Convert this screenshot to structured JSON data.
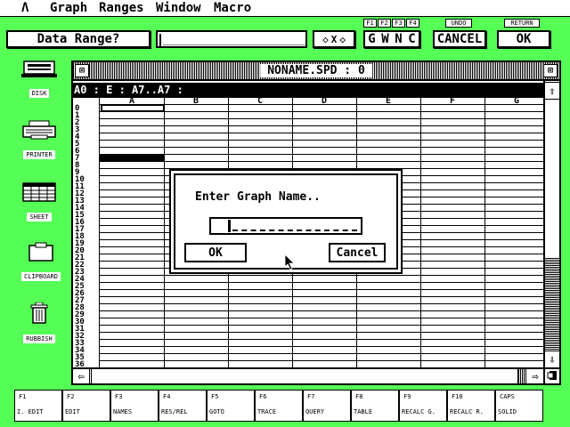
{
  "menubar": {
    "logo": "Λ",
    "items": [
      "Graph",
      "Ranges",
      "Window",
      "Macro"
    ]
  },
  "entry": {
    "prompt_label": "Data Range?",
    "input_value": "_______________________",
    "arrow_left": "◇",
    "x_label": "X",
    "arrow_right": "◇",
    "fkey_tags": [
      "F1",
      "F2",
      "F3",
      "F4"
    ],
    "fkey_letters": [
      "G",
      "W",
      "N",
      "C"
    ],
    "undo_tag": "UNDO",
    "cancel_label": "CANCEL",
    "return_tag": "RETURN",
    "ok_label": "OK"
  },
  "desktop": {
    "icons": [
      {
        "name": "disk",
        "label": "DISK"
      },
      {
        "name": "printer",
        "label": "PRINTER"
      },
      {
        "name": "sheet",
        "label": "SHEET"
      },
      {
        "name": "clipboard",
        "label": "CLIPBOARD"
      },
      {
        "name": "rubbish",
        "label": "RUBBISH"
      }
    ]
  },
  "sheet": {
    "title": "NONAME.SPD : 0",
    "cell_line": "A0 : E : A7..A7 :",
    "columns": [
      "A",
      "B",
      "C",
      "D",
      "E",
      "F",
      "G"
    ],
    "rows": [
      "0",
      "1",
      "2",
      "3",
      "4",
      "5",
      "6",
      "7",
      "8",
      "9",
      "10",
      "11",
      "12",
      "13",
      "14",
      "15",
      "16",
      "17",
      "18",
      "19",
      "20",
      "21",
      "22",
      "23",
      "24",
      "25",
      "26",
      "27",
      "28",
      "29",
      "30",
      "31",
      "32",
      "33",
      "34",
      "35",
      "36"
    ],
    "close_box": "⊠",
    "full_box": "⊠",
    "scroll_up": "⇧",
    "scroll_down": "⇩",
    "scroll_left": "⇦",
    "scroll_right": "⇨"
  },
  "dialog": {
    "title": "Enter Graph Name..",
    "ok_label": "OK",
    "cancel_label": "Cancel"
  },
  "fkeys": [
    {
      "num": "F1",
      "label": "I. EDIT"
    },
    {
      "num": "F2",
      "label": "EDIT"
    },
    {
      "num": "F3",
      "label": "NAMES"
    },
    {
      "num": "F4",
      "label": "RES/REL"
    },
    {
      "num": "F5",
      "label": "GOTO"
    },
    {
      "num": "F6",
      "label": "TRACE"
    },
    {
      "num": "F7",
      "label": "QUERY"
    },
    {
      "num": "F8",
      "label": "TABLE"
    },
    {
      "num": "F9",
      "label": "RECALC G."
    },
    {
      "num": "F10",
      "label": "RECALC R."
    },
    {
      "num": "CAPS",
      "label": "SOLID"
    }
  ],
  "colors": {
    "desktop": "#55ff55",
    "window": "#ffffff",
    "ink": "#000000"
  }
}
